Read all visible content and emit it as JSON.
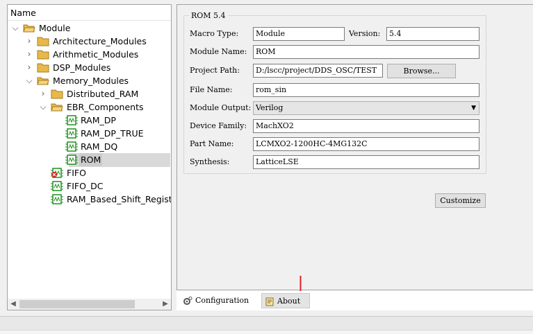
{
  "tree": {
    "header": "Name",
    "nodes": [
      {
        "label": "Module",
        "icon": "folder-open-icon",
        "expander": "expanded"
      },
      {
        "label": "Architecture_Modules",
        "icon": "folder-icon",
        "expander": "collapsed"
      },
      {
        "label": "Arithmetic_Modules",
        "icon": "folder-icon",
        "expander": "collapsed"
      },
      {
        "label": "DSP_Modules",
        "icon": "folder-icon",
        "expander": "collapsed"
      },
      {
        "label": "Memory_Modules",
        "icon": "folder-open-icon",
        "expander": "expanded"
      },
      {
        "label": "Distributed_RAM",
        "icon": "folder-icon",
        "expander": "collapsed"
      },
      {
        "label": "EBR_Components",
        "icon": "folder-open-icon",
        "expander": "expanded"
      },
      {
        "label": "RAM_DP",
        "icon": "chip-icon",
        "expander": "none"
      },
      {
        "label": "RAM_DP_TRUE",
        "icon": "chip-icon",
        "expander": "none"
      },
      {
        "label": "RAM_DQ",
        "icon": "chip-icon",
        "expander": "none"
      },
      {
        "label": "ROM",
        "icon": "chip-icon",
        "expander": "none",
        "selected": true
      },
      {
        "label": "FIFO",
        "icon": "chip-error-icon",
        "expander": "none"
      },
      {
        "label": "FIFO_DC",
        "icon": "chip-icon",
        "expander": "none"
      },
      {
        "label": "RAM_Based_Shift_Register",
        "icon": "chip-icon",
        "expander": "none"
      }
    ]
  },
  "config": {
    "group_title": "ROM 5.4",
    "macro_type_label": "Macro Type:",
    "macro_type": "Module",
    "version_label": "Version:",
    "version": "5.4",
    "module_name_label": "Module Name:",
    "module_name": "ROM",
    "project_path_label": "Project Path:",
    "project_path": "D:/lscc/project/DDS_OSC/TEST",
    "browse_label": "Browse...",
    "file_name_label": "File Name:",
    "file_name": "rom_sin",
    "module_output_label": "Module Output:",
    "module_output": "Verilog",
    "device_family_label": "Device Family:",
    "device_family": "MachXO2",
    "part_name_label": "Part Name:",
    "part_name": "LCMXO2-1200HC-4MG132C",
    "synthesis_label": "Synthesis:",
    "synthesis": "LatticeLSE",
    "customize_label": "Customize"
  },
  "tabs": [
    {
      "label": "Configuration",
      "icon": "gear-icon"
    },
    {
      "label": "About",
      "icon": "book-icon"
    }
  ],
  "colors": {
    "folder": "#e8b84a",
    "chip": "#1f8f1f",
    "error": "#d22020",
    "annotation": "#e02020"
  }
}
